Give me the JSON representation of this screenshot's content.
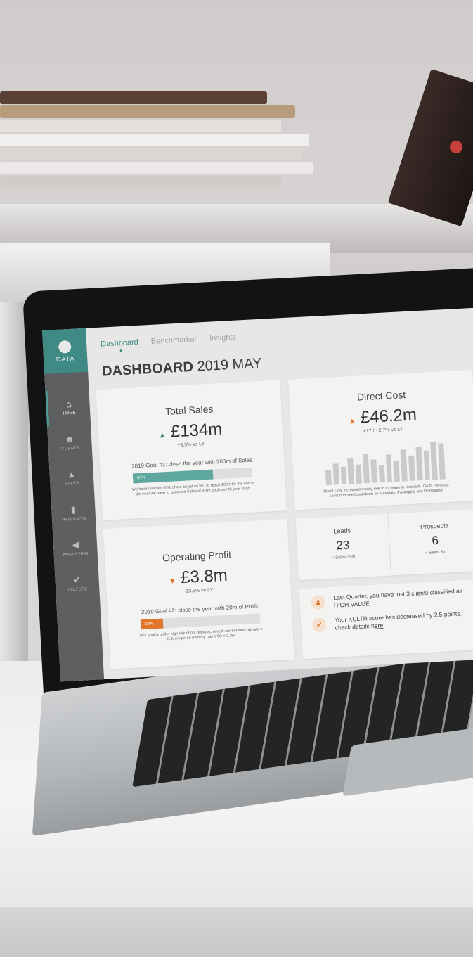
{
  "colors": {
    "accent": "#3f8a84",
    "warning": "#e0762a",
    "sidebar": "#5d5f60"
  },
  "logo": {
    "text": "DATA"
  },
  "sidebar": {
    "items": [
      {
        "label": "HOME",
        "icon": "home-icon"
      },
      {
        "label": "CLIENTS",
        "icon": "users-icon"
      },
      {
        "label": "SALES",
        "icon": "bag-icon"
      },
      {
        "label": "PRODUCTS",
        "icon": "bars-icon"
      },
      {
        "label": "MARKETING",
        "icon": "megaphone-icon"
      },
      {
        "label": "CULTURE",
        "icon": "check-icon"
      }
    ]
  },
  "tabs": [
    {
      "label": "Dashboard",
      "active": true
    },
    {
      "label": "Benchmarker",
      "active": false
    },
    {
      "label": "Insights",
      "active": false
    }
  ],
  "page": {
    "title_bold": "DASHBOARD",
    "title_rest": "2019 MAY"
  },
  "total_sales": {
    "title": "Total Sales",
    "value": "£134m",
    "change": "+3.5% vs LY",
    "goal": "2019 Goal #1: close the year with 200m of Sales",
    "progress_label": "67%",
    "progress": 0.67,
    "note": "We have reached 67% of our target so far. To reach 200m by the end of the year we have to generate Sales of 8.4m each month year to go."
  },
  "direct_cost": {
    "title": "Direct Cost",
    "value": "£46.2m",
    "change": "+17 / +2.7% vs LY",
    "note": "Direct Cost increased mostly due to increase in Materials. Go to Products section to see breakdown by Materials, Packaging and Distribution",
    "bars": [
      0.35,
      0.5,
      0.42,
      0.6,
      0.45,
      0.7,
      0.55,
      0.4,
      0.65,
      0.5,
      0.75,
      0.6,
      0.8,
      0.7,
      0.9,
      0.85
    ]
  },
  "operating_profit": {
    "title": "Operating Profit",
    "value": "£3.8m",
    "change": "-13.5% vs LY",
    "goal": "2019 Goal #2: close the year with 20m of Profit",
    "progress_label": "19%",
    "progress": 0.19,
    "note": "This goal is under high risk of not being achieved. current monthly rate = 0.3m required monthly rate YTG = 2.3m"
  },
  "leads": {
    "label": "Leads",
    "value": "23",
    "sub": "~ Sales 35m"
  },
  "prospects": {
    "label": "Prospects",
    "value": "6",
    "sub": "~ Sales 5m"
  },
  "alerts": [
    {
      "icon": "alert-icon",
      "text": "Last Quarter, you have lost 3 clients classified as HIGH VALUE"
    },
    {
      "icon": "check-icon",
      "text": "Your KULTR score has decreased by 2.5 points, check details",
      "link": "here"
    }
  ]
}
